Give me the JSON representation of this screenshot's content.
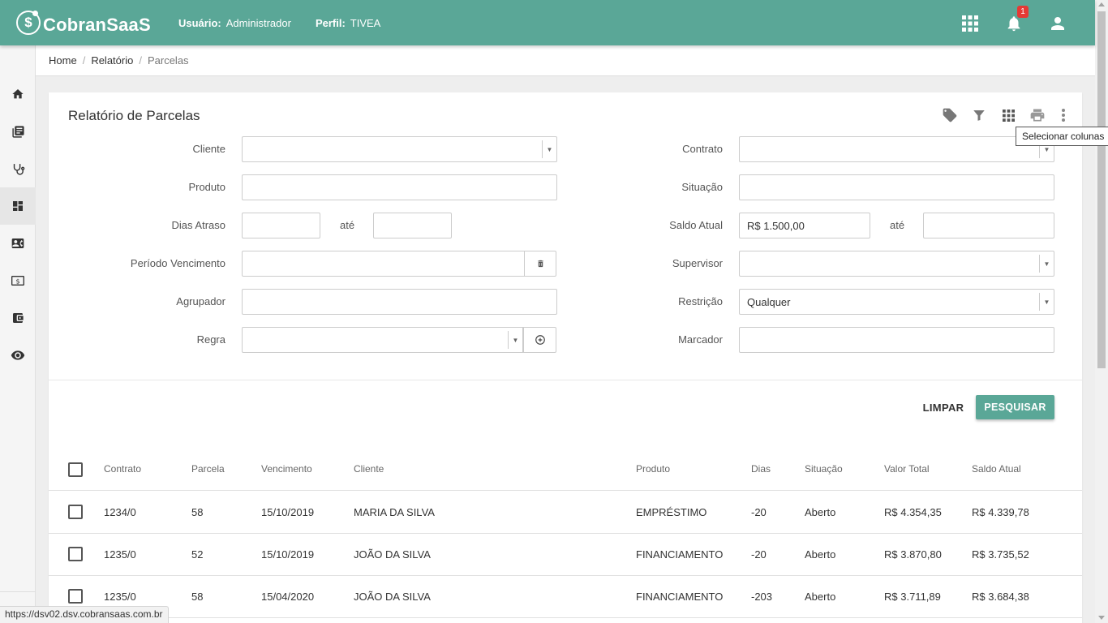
{
  "header": {
    "logo_symbol": "$",
    "logo_text": "CobranSaaS",
    "user_label": "Usuário:",
    "user_value": "Administrador",
    "profile_label": "Perfil:",
    "profile_value": "TIVEA",
    "notification_count": "1",
    "icons": [
      "apps-icon",
      "bell-icon",
      "account-icon"
    ]
  },
  "sidebar": {
    "items": [
      {
        "icon": "home-icon"
      },
      {
        "icon": "book-icon"
      },
      {
        "icon": "stethoscope-icon"
      },
      {
        "icon": "dashboard-icon",
        "active": true
      },
      {
        "icon": "contact-card-icon"
      },
      {
        "icon": "money-icon"
      },
      {
        "icon": "wallet-icon"
      },
      {
        "icon": "eye-icon"
      }
    ]
  },
  "breadcrumb": {
    "home": "Home",
    "relatorio": "Relatório",
    "current": "Parcelas"
  },
  "card": {
    "title": "Relatório de Parcelas",
    "tools": [
      "tag-icon",
      "filter-icon",
      "columns-icon",
      "print-icon",
      "more-vert-icon"
    ],
    "tooltip": "Selecionar colunas"
  },
  "form": {
    "cliente_label": "Cliente",
    "produto_label": "Produto",
    "dias_atraso_label": "Dias Atraso",
    "ate_label": "até",
    "periodo_label": "Período Vencimento",
    "agrupador_label": "Agrupador",
    "regra_label": "Regra",
    "contrato_label": "Contrato",
    "situacao_label": "Situação",
    "saldo_label": "Saldo Atual",
    "saldo_from_value": "R$ 1.500,00",
    "supervisor_label": "Supervisor",
    "restricao_label": "Restrição",
    "restricao_value": "Qualquer",
    "marcador_label": "Marcador"
  },
  "actions": {
    "limpar": "LIMPAR",
    "pesquisar": "PESQUISAR"
  },
  "table": {
    "columns": [
      "Contrato",
      "Parcela",
      "Vencimento",
      "Cliente",
      "Produto",
      "Dias",
      "Situação",
      "Valor Total",
      "Saldo Atual"
    ],
    "rows": [
      [
        "1234/0",
        "58",
        "15/10/2019",
        "MARIA DA SILVA",
        "EMPRÉSTIMO",
        "-20",
        "Aberto",
        "R$ 4.354,35",
        "R$ 4.339,78"
      ],
      [
        "1235/0",
        "52",
        "15/10/2019",
        "JOÃO DA SILVA",
        "FINANCIAMENTO",
        "-20",
        "Aberto",
        "R$ 3.870,80",
        "R$ 3.735,52"
      ],
      [
        "1235/0",
        "58",
        "15/04/2020",
        "JOÃO DA SILVA",
        "FINANCIAMENTO",
        "-203",
        "Aberto",
        "R$ 3.711,89",
        "R$ 3.684,38"
      ]
    ]
  },
  "status_url": "https://dsv02.dsv.cobransaas.com.br",
  "colors": {
    "primary": "#5aa797",
    "badge": "#e53935"
  }
}
